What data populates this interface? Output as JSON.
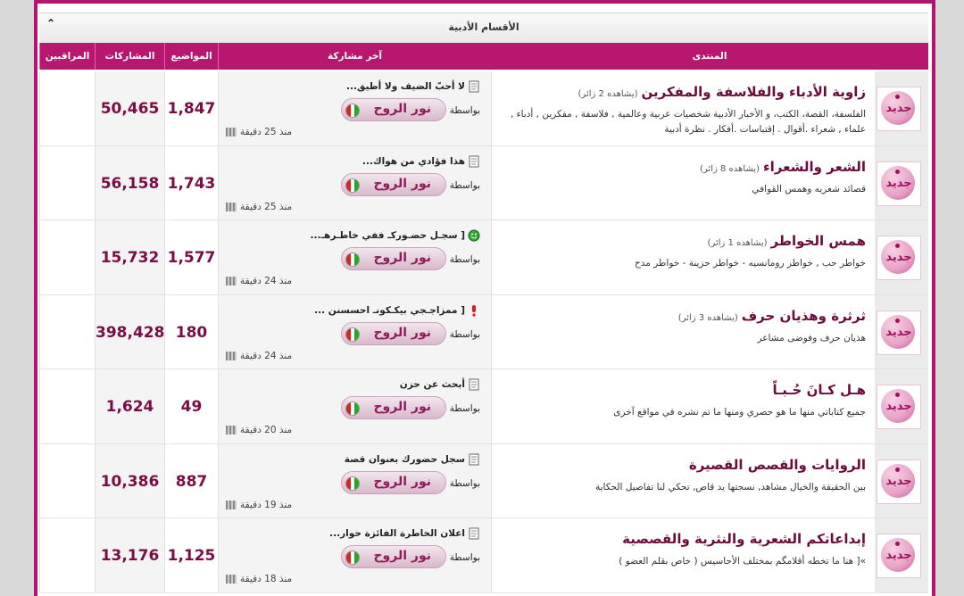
{
  "category": {
    "title": "الأقسام الأدبية",
    "collapse_icon": "collapse-icon"
  },
  "headers": {
    "forum": "المنتدى",
    "last_post": "آخر مشاركة",
    "topics": "المواضيع",
    "posts": "المشاركات",
    "moderators": "المراقبين"
  },
  "badge_text": "جديد",
  "by_label": "بواسطة",
  "colors": {
    "header": "#b8176f",
    "accent": "#7a0d45"
  },
  "forums": [
    {
      "title": "زاوية الأدباء والفلاسفة والمفكرين",
      "viewers": "(يشاهده 2 زائر)",
      "description": "الفلسفة، القصة، الكتب، و الأخبار الأدبية شخصيات عربية وعالمية , فلاسفة , مفكرين , أدباء , علماء , شعراء .أقوال . إقتباسات .أفكار . نظرة أدبية",
      "last_title": "لا أحبّ الضيف ولا أطيق...",
      "last_icon": "document-icon",
      "last_user": "نور الروح",
      "last_time": "منذ 25 دقيقة",
      "topics": "1,847",
      "posts": "50,465",
      "mods": ""
    },
    {
      "title": "الشعر والشعراء",
      "viewers": "(يشاهده 8 زائر)",
      "description": "قصائد شعريه وهمس القوافي",
      "last_title": "هذا فؤادي من هواك...",
      "last_icon": "document-icon",
      "last_user": "نور الروح",
      "last_time": "منذ 25 دقيقة",
      "topics": "1,743",
      "posts": "56,158",
      "mods": ""
    },
    {
      "title": "همس الخواطر",
      "viewers": "(يشاهده 1 زائر)",
      "description": "خواطر حب , خواطر رومانسيه - خواطر حزينة - خواطر مدح",
      "last_title": "[ سجـل حضـوركـ ففي خاطـرهـ...",
      "last_icon": "smiley-icon",
      "last_user": "نور الروح",
      "last_time": "منذ 24 دقيقة",
      "topics": "1,577",
      "posts": "15,732",
      "mods": ""
    },
    {
      "title": "ثرثرة وهذيان حرف",
      "viewers": "(يشاهده 3 زائر)",
      "description": "هذيان حرف وفوضى مشاعر",
      "last_title": "[ ممزاجـجي بيكـكونـ احسسنن ...",
      "last_icon": "exclamation-icon",
      "last_user": "نور الروح",
      "last_time": "منذ 24 دقيقة",
      "topics": "180",
      "posts": "398,428",
      "mods": ""
    },
    {
      "title": "هـل كـانَ حُـبـاً",
      "viewers": "",
      "description": "جميع كتاباتي منها ما هو حصري ومنها ما تم نشره في مواقع آخرى",
      "last_title": "أبحث عن حزن",
      "last_icon": "document-icon",
      "last_user": "نور الروح",
      "last_time": "منذ 20 دقيقة",
      "topics": "49",
      "posts": "1,624",
      "mods": ""
    },
    {
      "title": "الروايات والقصص القصيرة",
      "viewers": "",
      "description": "بين الحقيقة والخيال مشاهد, نسجتها يد قاص, تحكي لنا تفاصيل الحكاية",
      "last_title": "سجل حضورك بعنوان قصة",
      "last_icon": "document-icon",
      "last_user": "نور الروح",
      "last_time": "منذ 19 دقيقة",
      "topics": "887",
      "posts": "10,386",
      "mods": ""
    },
    {
      "title": "إبداعاتكم الشعرية والنثرية والقصصية",
      "viewers": "",
      "description": "»[ هنا ما تخطه أقلامگم بمختلف الأحاسيس ( خاص بقلم العضو )",
      "last_title": "اعلان الخاطرة الفائزة حوار...",
      "last_icon": "document-icon",
      "last_user": "نور الروح",
      "last_time": "منذ 18 دقيقة",
      "topics": "1,125",
      "posts": "13,176",
      "mods": ""
    }
  ]
}
